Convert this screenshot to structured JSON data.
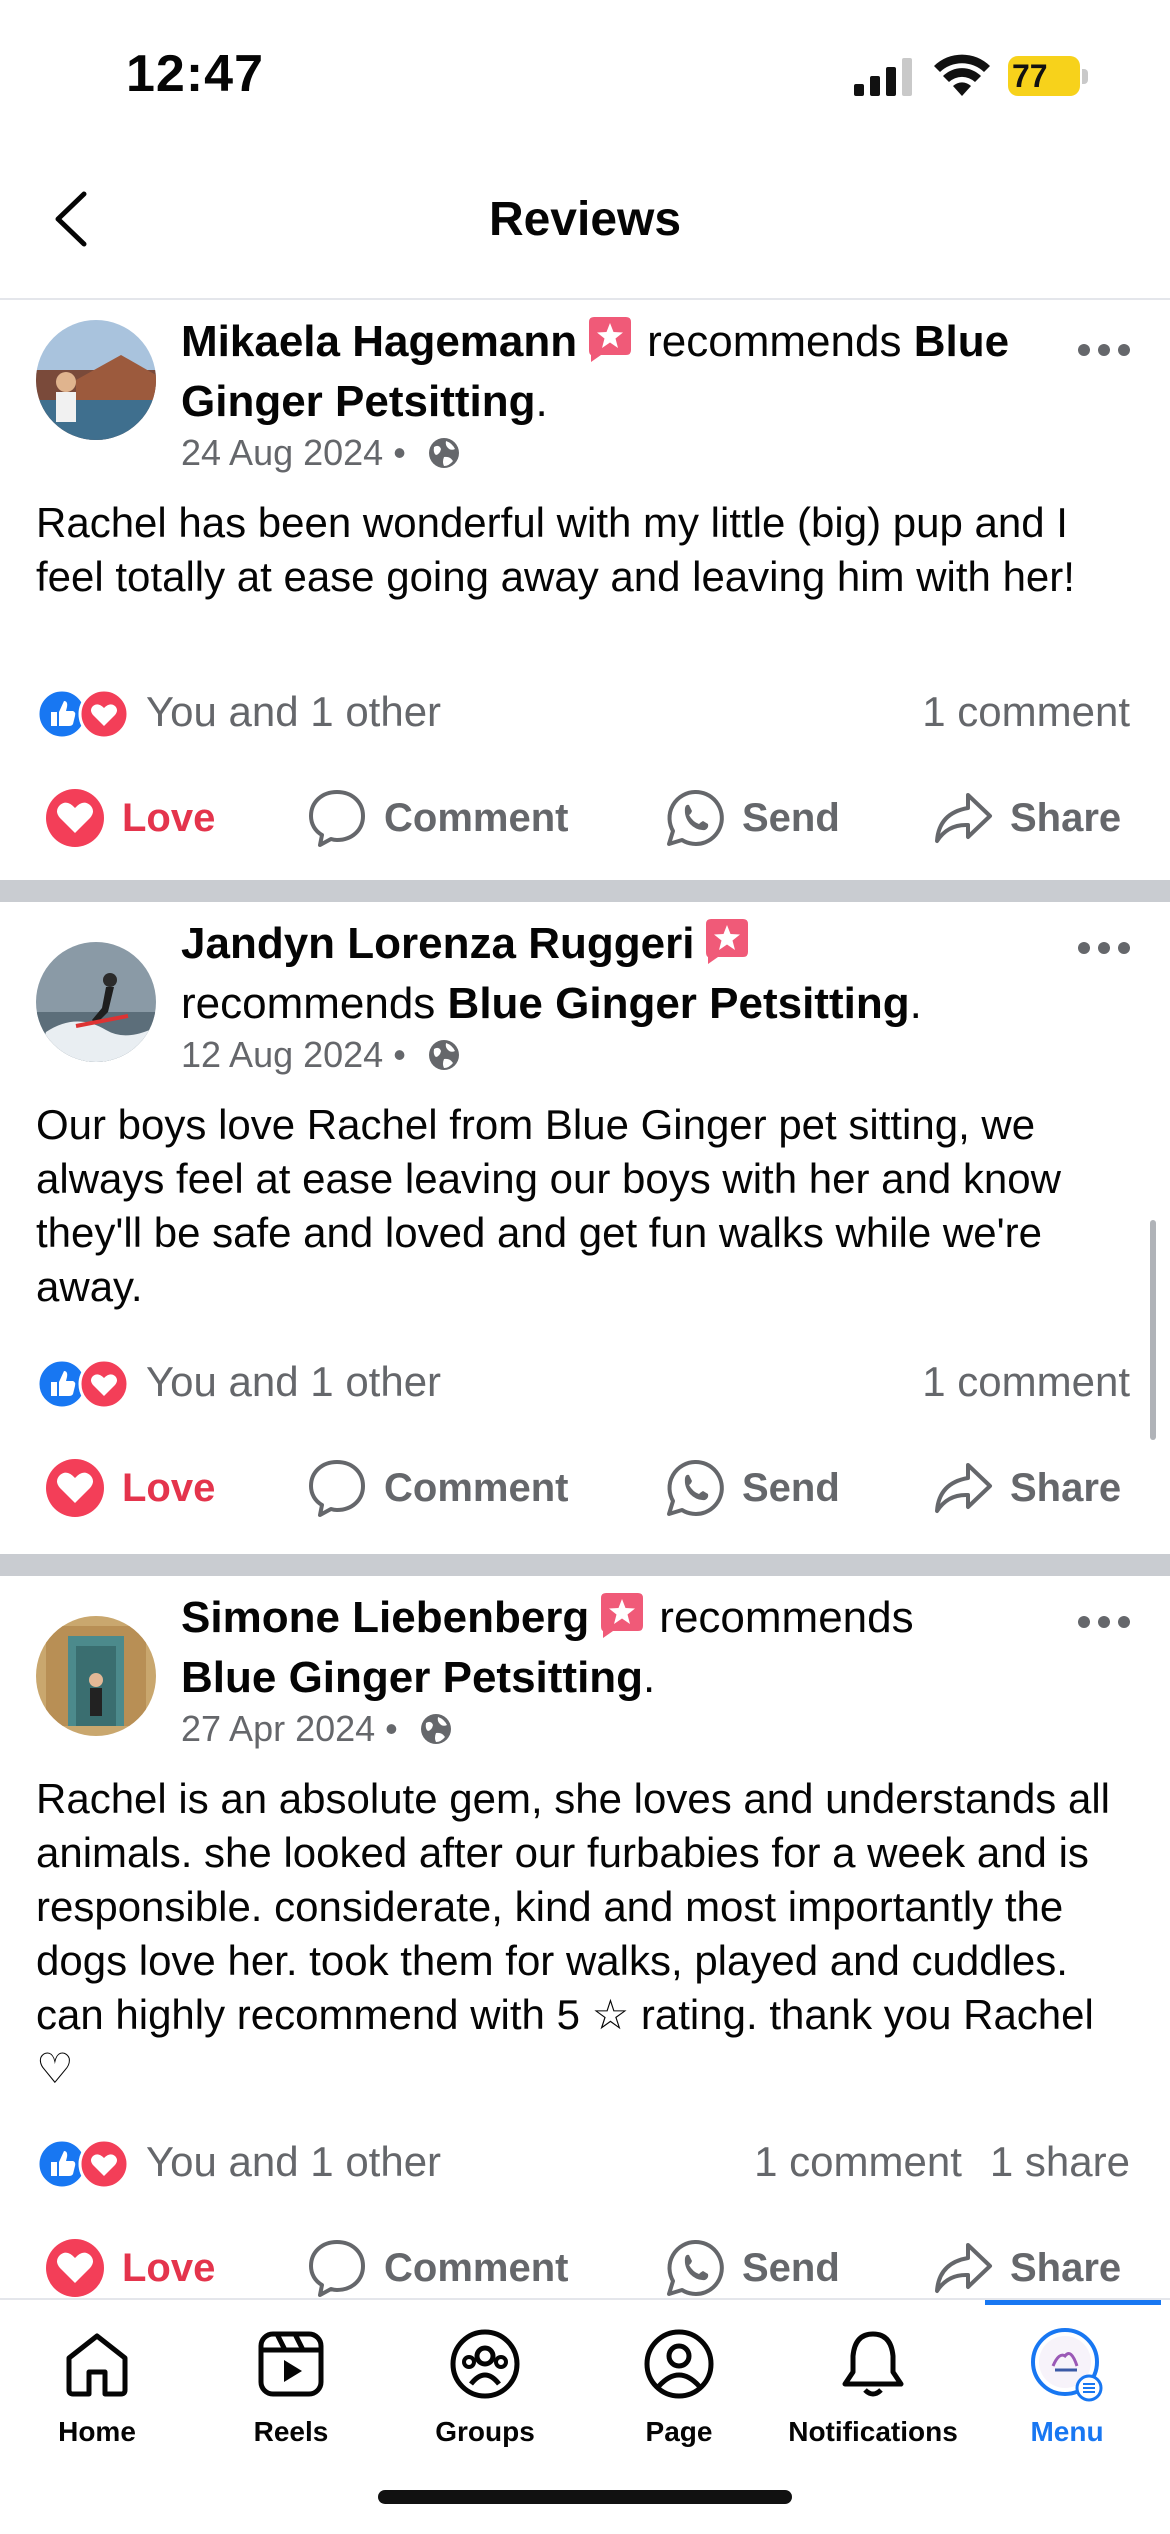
{
  "status_bar": {
    "time": "12:47",
    "battery": "77"
  },
  "header": {
    "title": "Reviews"
  },
  "common": {
    "recommends": "recommends",
    "separator": " • ",
    "period": ".",
    "actions": {
      "love": "Love",
      "comment": "Comment",
      "send": "Send",
      "share": "Share"
    }
  },
  "posts": [
    {
      "author": "Mikaela Hagemann",
      "page": "Blue Ginger Petsitting",
      "date": "24 Aug 2024",
      "text": "Rachel has been wonderful with my little (big) pup and I feel totally at ease going away and leaving him with her!",
      "reactions": "You and 1 other",
      "comments": "1 comment",
      "shares": ""
    },
    {
      "author": "Jandyn Lorenza Ruggeri",
      "page": "Blue Ginger Petsitting",
      "date": "12 Aug 2024",
      "text": "Our boys love Rachel from Blue Ginger pet sitting, we always feel at ease leaving our boys with her and know they'll be safe and loved and get fun walks while we're away.",
      "reactions": "You and 1 other",
      "comments": "1 comment",
      "shares": ""
    },
    {
      "author": "Simone Liebenberg",
      "page": "Blue Ginger Petsitting",
      "date": "27 Apr 2024",
      "text": "Rachel is an absolute gem, she loves and understands all animals. she looked after our furbabies for a week and is responsible. considerate, kind and most importantly the dogs love her. took them for walks, played and cuddles. can highly recommend with 5 ☆ rating. thank you Rachel ♡",
      "reactions": "You and 1 other",
      "comments": "1 comment",
      "shares": "1 share"
    }
  ],
  "tabs": [
    {
      "label": "Home",
      "icon": "home-icon"
    },
    {
      "label": "Reels",
      "icon": "reels-icon"
    },
    {
      "label": "Groups",
      "icon": "groups-icon"
    },
    {
      "label": "Page",
      "icon": "page-icon"
    },
    {
      "label": "Notifications",
      "icon": "bell-icon"
    },
    {
      "label": "Menu",
      "icon": "menu-avatar-icon",
      "active": true
    }
  ],
  "colors": {
    "accent": "#1877f2",
    "love": "#e4344c",
    "secondary_text": "#65676b",
    "divider": "#c9ccd1"
  }
}
